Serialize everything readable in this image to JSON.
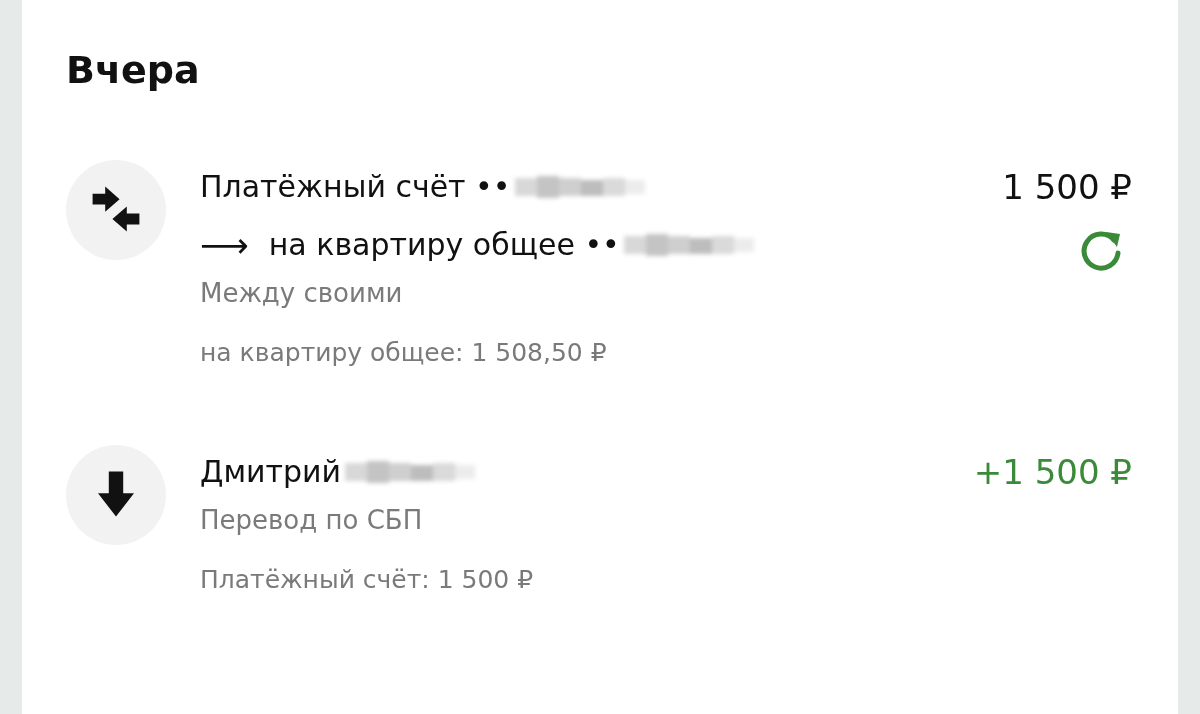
{
  "heading": "Вчера",
  "operations": [
    {
      "kind": "transfer",
      "lines": [
        {
          "text": "Платёжный счёт ••",
          "masked": true
        },
        {
          "prefix": "⟶",
          "text": "на квартиру общее ••",
          "masked": true
        }
      ],
      "category": "Между своими",
      "balance": "на квартиру общее: 1 508,50 ₽",
      "amount": "1 500 ₽",
      "incoming": false,
      "repeat": true
    },
    {
      "kind": "incoming",
      "lines": [
        {
          "text": "Дмитрий",
          "masked": true
        }
      ],
      "category": "Перевод по СБП",
      "balance": "Платёжный счёт: 1 500 ₽",
      "amount": "+1 500 ₽",
      "incoming": true,
      "repeat": false
    }
  ]
}
